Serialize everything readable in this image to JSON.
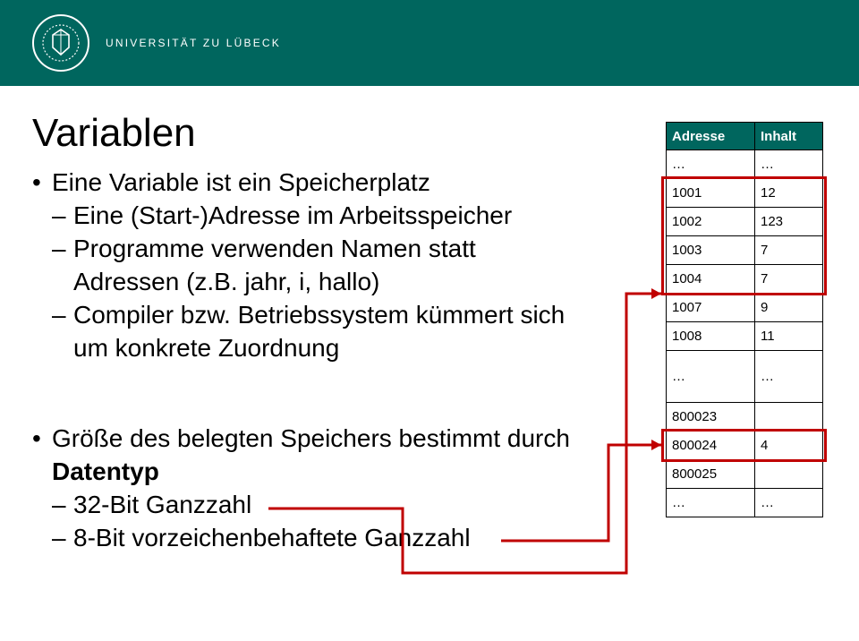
{
  "header": {
    "university": "UNIVERSITÄT ZU LÜBECK"
  },
  "title": "Variablen",
  "bullet_main": "Eine Variable ist ein Speicherplatz",
  "sub1": "Eine (Start-)Adresse im Arbeitsspeicher",
  "sub2": "Programme verwenden Namen statt Adressen (z.B. jahr, i, hallo)",
  "sub3": "Compiler bzw. Betriebssystem kümmert sich um konkrete Zuordnung",
  "bullet2_prefix": "Größe des belegten Speichers bestimmt durch ",
  "bullet2_bold": "Datentyp",
  "sub4": "32-Bit Ganzzahl",
  "sub5": "8-Bit vorzeichenbehaftete Ganzzahl",
  "mem": {
    "head_addr": "Adresse",
    "head_val": "Inhalt",
    "rows": [
      {
        "addr": "…",
        "val": "…"
      },
      {
        "addr": "1001",
        "val": "12"
      },
      {
        "addr": "1002",
        "val": "123"
      },
      {
        "addr": "1003",
        "val": "7"
      },
      {
        "addr": "1004",
        "val": "7"
      },
      {
        "addr": "1007",
        "val": "9"
      },
      {
        "addr": "1008",
        "val": "11"
      },
      {
        "addr": "…",
        "val": "…"
      },
      {
        "addr": "800023",
        "val": ""
      },
      {
        "addr": "800024",
        "val": "4"
      },
      {
        "addr": "800025",
        "val": ""
      },
      {
        "addr": "…",
        "val": "…"
      }
    ]
  }
}
